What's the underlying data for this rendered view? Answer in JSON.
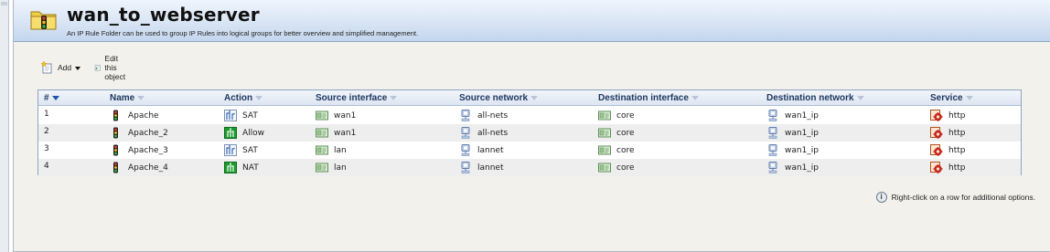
{
  "header": {
    "title": "wan_to_webserver",
    "description": "An IP Rule Folder can be used to group IP Rules into logical groups for better overview and simplified management."
  },
  "toolbar": {
    "add_label": "Add",
    "edit_label": "Edit this object"
  },
  "table": {
    "columns": {
      "num": "#",
      "name": "Name",
      "action": "Action",
      "src_if": "Source interface",
      "src_net": "Source network",
      "dst_if": "Destination interface",
      "dst_net": "Destination network",
      "service": "Service"
    },
    "rows": [
      {
        "num": "1",
        "name": "Apache",
        "action": "SAT",
        "src_if": "wan1",
        "src_net": "all-nets",
        "dst_if": "core",
        "dst_net": "wan1_ip",
        "service": "http"
      },
      {
        "num": "2",
        "name": "Apache_2",
        "action": "Allow",
        "src_if": "wan1",
        "src_net": "all-nets",
        "dst_if": "core",
        "dst_net": "wan1_ip",
        "service": "http"
      },
      {
        "num": "3",
        "name": "Apache_3",
        "action": "SAT",
        "src_if": "lan",
        "src_net": "lannet",
        "dst_if": "core",
        "dst_net": "wan1_ip",
        "service": "http"
      },
      {
        "num": "4",
        "name": "Apache_4",
        "action": "NAT",
        "src_if": "lan",
        "src_net": "lannet",
        "dst_if": "core",
        "dst_net": "wan1_ip",
        "service": "http"
      }
    ]
  },
  "hint": "Right-click on a row for additional options.",
  "colors": {
    "header_gradient_bottom": "#c4d6ee",
    "grid_border": "#8ea4c4",
    "alt_row": "#eeeeee",
    "allow_green": "#1c9b2f",
    "service_red": "#c8281e"
  }
}
